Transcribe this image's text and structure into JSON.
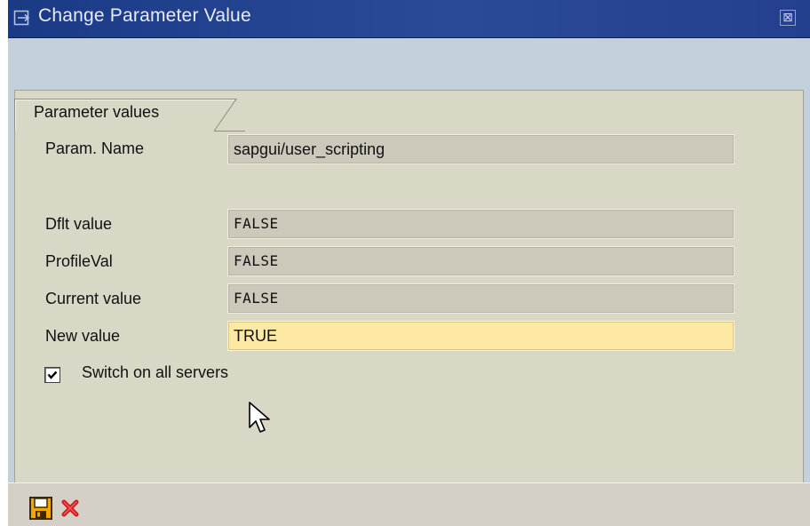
{
  "window": {
    "title": "Change Parameter Value",
    "title_icon": "parameter-window-icon",
    "close_icon": "close-icon",
    "close_glyph": "⊠"
  },
  "tab": {
    "label": "Parameter values"
  },
  "fields": {
    "param_name": {
      "label": "Param. Name",
      "value": "sapgui/user_scripting"
    },
    "default_value": {
      "label": "Dflt value",
      "value": "FALSE"
    },
    "profile_value": {
      "label": "ProfileVal",
      "value": "FALSE"
    },
    "current_value": {
      "label": "Current value",
      "value": "FALSE"
    },
    "new_value": {
      "label": "New value",
      "value": "TRUE"
    }
  },
  "checkbox": {
    "label": "Switch on all servers",
    "checked": true
  },
  "toolbar": {
    "save_icon": "save-icon",
    "cancel_icon": "cancel-icon"
  },
  "colors": {
    "titlebar": "#1b3a86",
    "panel": "#d9d7c5",
    "field_readonly": "#ccc9ba",
    "field_input": "#fde8a4",
    "save_icon": "#f0a800",
    "cancel_icon": "#d11a1a"
  }
}
